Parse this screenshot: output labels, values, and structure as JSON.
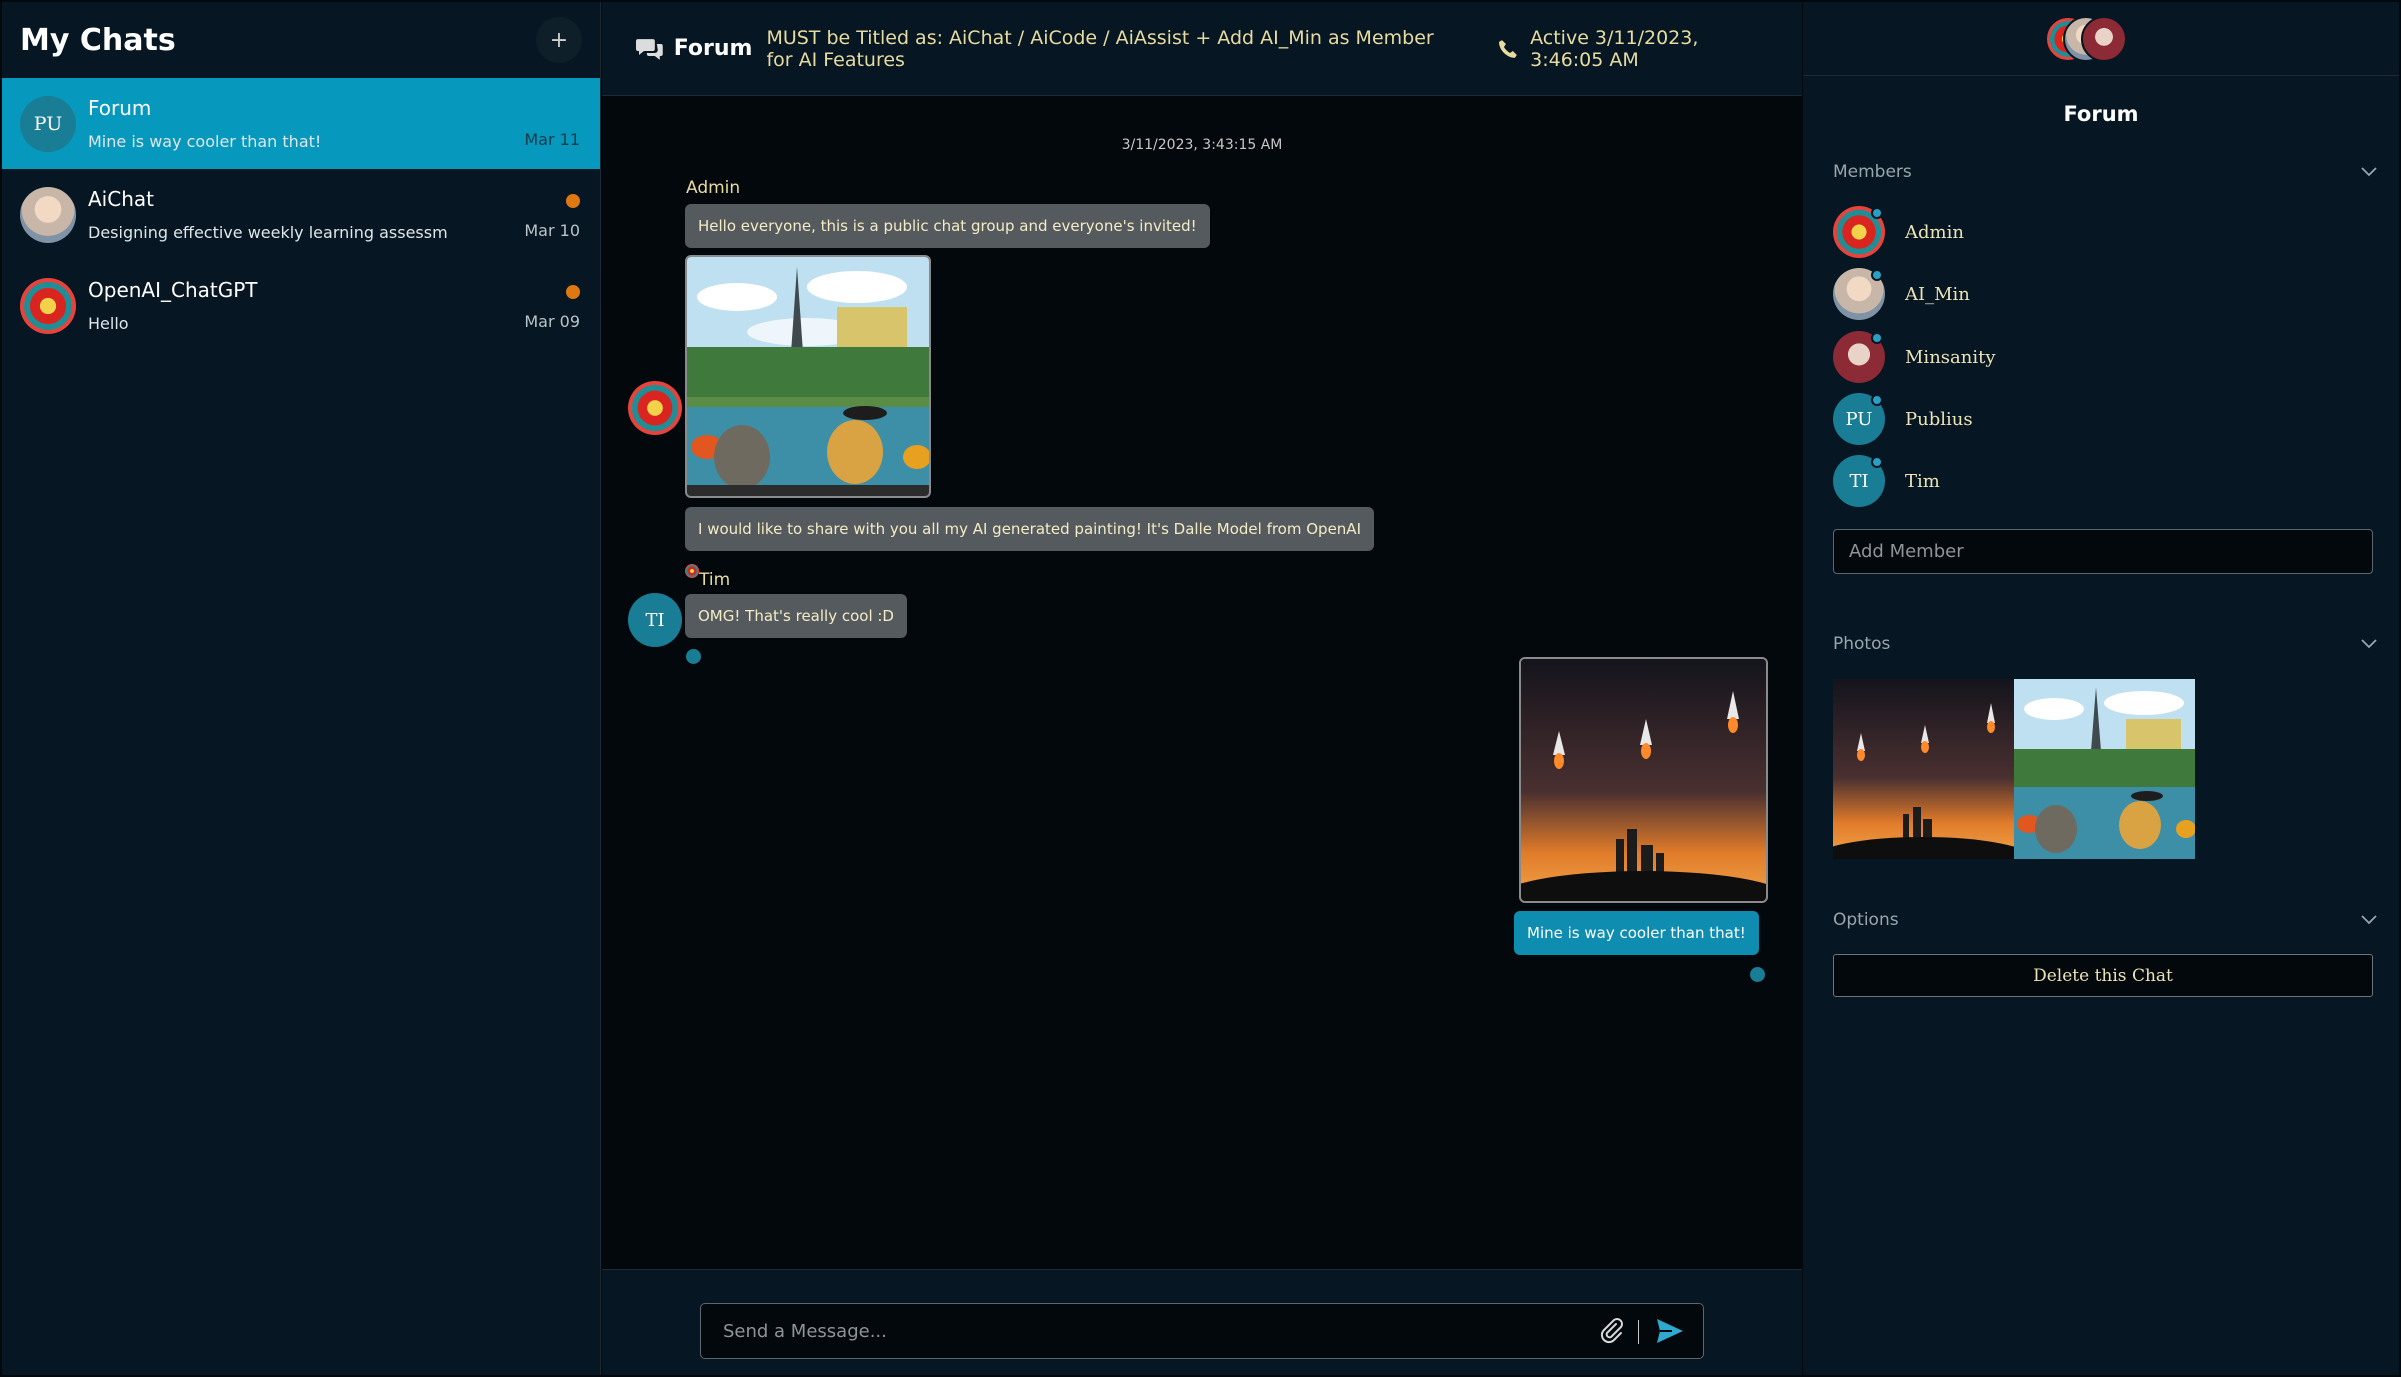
{
  "left": {
    "title": "My Chats",
    "new_chat_label": "+",
    "chats": [
      {
        "initials": "PU",
        "name": "Forum",
        "last": "Mine is way cooler than that!",
        "date": "Mar 11",
        "active": true,
        "unread": false
      },
      {
        "initials": "",
        "name": "AiChat",
        "last": "Designing effective weekly learning assessm",
        "date": "Mar 10",
        "active": false,
        "unread": true
      },
      {
        "initials": "",
        "name": "OpenAI_ChatGPT",
        "last": "Hello",
        "date": "Mar 09",
        "active": false,
        "unread": true
      }
    ]
  },
  "header": {
    "name": "Forum",
    "description": "MUST be Titled as: AiChat / AiCode / AiAssist + Add AI_Min as Member for AI Features",
    "status": "Active 3/11/2023, 3:46:05 AM",
    "icons": {
      "forum": "chat-bubbles-icon",
      "status": "phone-icon"
    }
  },
  "messages": {
    "date_separator": "3/11/2023, 3:43:15 AM",
    "admin_sender": "Admin",
    "admin_text": "Hello everyone, this is a public chat group and everyone's invited!",
    "admin_text2": "I would like to share with you all my AI generated painting! It's Dalle Model from OpenAI",
    "tim_sender": "Tim",
    "tim_initials": "TI",
    "tim_text": "OMG! That's really cool :D",
    "mine_text": "Mine is way cooler than that!"
  },
  "composer": {
    "placeholder": "Send a Message...",
    "icons": {
      "attach": "paperclip-icon",
      "send": "send-icon"
    }
  },
  "right": {
    "title": "Forum",
    "members_label": "Members",
    "members": [
      {
        "name": "Admin",
        "initials": ""
      },
      {
        "name": "AI_Min",
        "initials": ""
      },
      {
        "name": "Minsanity",
        "initials": ""
      },
      {
        "name": "Publius",
        "initials": "PU"
      },
      {
        "name": "Tim",
        "initials": "TI"
      }
    ],
    "add_member_placeholder": "Add Member",
    "photos_label": "Photos",
    "options_label": "Options",
    "delete_label": "Delete this Chat"
  },
  "colors": {
    "accent": "#0798bd",
    "unread": "#e07811",
    "bubble": "#555a5e",
    "text_yellow": "#e8dba0"
  }
}
